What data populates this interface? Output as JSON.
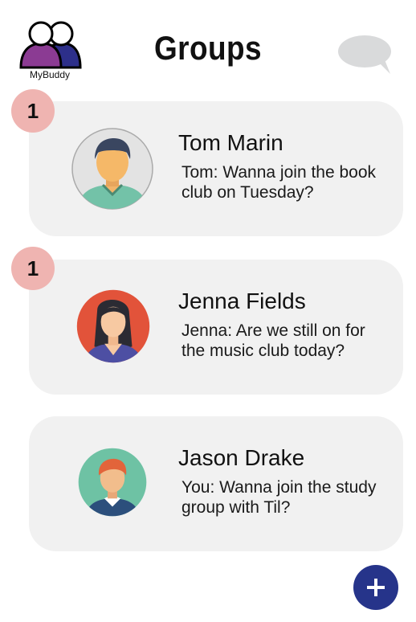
{
  "app": {
    "logo_label": "MyBuddy",
    "title": "Groups"
  },
  "groups": [
    {
      "name": "Tom Marin",
      "preview": "Tom: Wanna join the book club on Tuesday?",
      "unread": "1",
      "avatar": "male-avatar-teal-shirt"
    },
    {
      "name": "Jenna Fields",
      "preview": "Jenna: Are we still on for the music club today?",
      "unread": "1",
      "avatar": "female-avatar-orange-background"
    },
    {
      "name": "Jason Drake",
      "preview": "You: Wanna join the study group with Til?",
      "unread": "",
      "avatar": "male-avatar-redhair-teal-background"
    }
  ],
  "icons": {
    "chat": "chat-bubble-icon",
    "add": "plus-icon"
  },
  "colors": {
    "badge": "#efb4b1",
    "fab": "#26348a",
    "card": "#f1f1f1"
  }
}
